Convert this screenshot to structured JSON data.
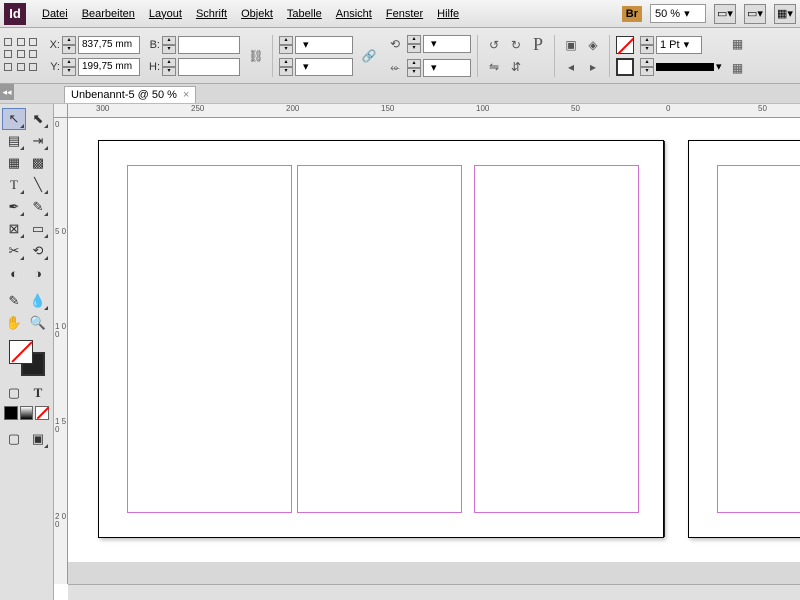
{
  "app": {
    "logo": "Id"
  },
  "menu": {
    "datei": "Datei",
    "bearbeiten": "Bearbeiten",
    "layout": "Layout",
    "schrift": "Schrift",
    "objekt": "Objekt",
    "tabelle": "Tabelle",
    "ansicht": "Ansicht",
    "fenster": "Fenster",
    "hilfe": "Hilfe"
  },
  "menubar_right": {
    "bridge": "Br",
    "zoom": "50 %"
  },
  "control": {
    "x_label": "X:",
    "x_value": "837,75 mm",
    "y_label": "Y:",
    "y_value": "199,75 mm",
    "w_label": "B:",
    "w_value": "",
    "h_label": "H:",
    "h_value": "",
    "stroke_weight": "1 Pt"
  },
  "tab": {
    "title": "Unbenannt-5 @ 50 %",
    "close": "×"
  },
  "ruler": {
    "h_ticks": [
      "300",
      "250",
      "200",
      "150",
      "100",
      "50",
      "0",
      "50"
    ],
    "v_ticks": [
      "0",
      "5 0",
      "1 0 0",
      "1 5 0",
      "2 0 0"
    ]
  }
}
